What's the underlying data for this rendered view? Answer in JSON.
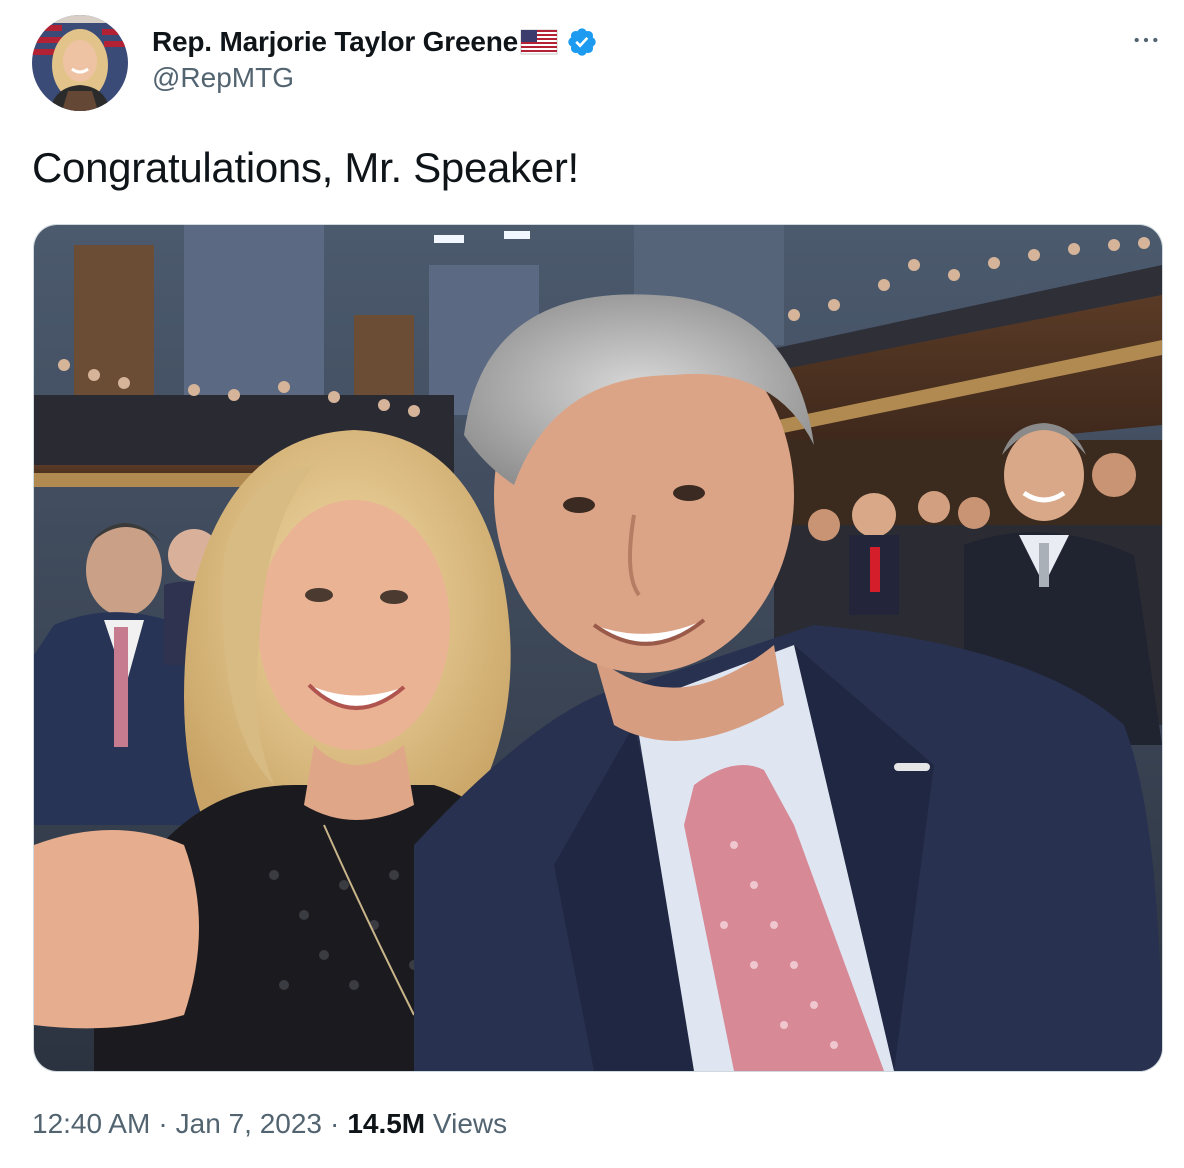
{
  "author": {
    "display_name": "Rep. Marjorie Taylor Greene",
    "handle": "@RepMTG",
    "verified": true,
    "flag_icon": "us-flag-icon",
    "verified_color": "#1d9bf0"
  },
  "tweet": {
    "text": "Congratulations, Mr. Speaker!",
    "media": {
      "type": "photo"
    }
  },
  "meta": {
    "time": "12:40 AM",
    "date": "Jan 7, 2023",
    "views_count": "14.5M",
    "views_label": "Views",
    "separator": "·"
  },
  "menu": {
    "icon": "more-horizontal-icon"
  },
  "colors": {
    "text_primary": "#0f1419",
    "text_secondary": "#536471",
    "border": "#cfd9de",
    "accent": "#1d9bf0"
  }
}
